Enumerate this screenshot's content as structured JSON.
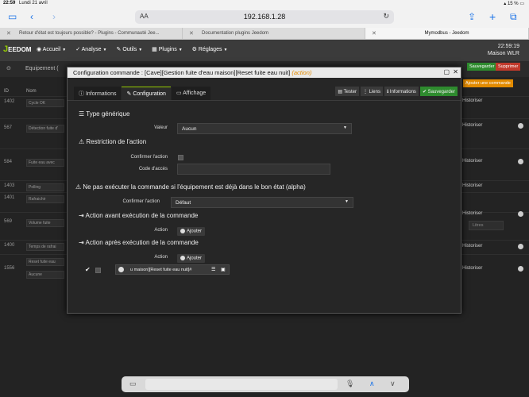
{
  "statusbar": {
    "time": "22:59",
    "date": "Lundi 21 avril",
    "battery": "15 %"
  },
  "browser": {
    "aa_label": "AA",
    "url": "192.168.1.28",
    "tabs": [
      {
        "label": "Retour d'état est toujours possible? - Plugins - Communauté Jee...",
        "active": false
      },
      {
        "label": "Documentation plugins Jeedom",
        "active": false
      },
      {
        "label": "Mymodbus - Jeedom",
        "active": true
      }
    ]
  },
  "navbar": {
    "logo": "EEDOM",
    "menu": [
      "Accueil",
      "Analyse",
      "Outils",
      "Plugins",
      "Réglages"
    ],
    "clock_time": "22:59:19",
    "clock_name": "Maison WLR"
  },
  "background": {
    "header_add": "Equipement (",
    "col_id": "ID",
    "col_nom": "Nom",
    "btn_save": "Sauvegarder",
    "btn_delete": "Supprimer",
    "btn_add_cmd": "Ajouter une commande",
    "rows": [
      {
        "id": "1402",
        "name": "Cycle OK",
        "right": "Historiser"
      },
      {
        "id": "567",
        "name": "Détection fuite d'",
        "right": "Historiser"
      },
      {
        "id": "584",
        "name": "Fuite eau avec",
        "right": "Historiser"
      },
      {
        "id": "1403",
        "name": "Polling",
        "right": "Historiser"
      },
      {
        "id": "1401",
        "name": "Rafraichir",
        "right": ""
      },
      {
        "id": "569",
        "name": "Volume fuite",
        "right": "Historiser"
      },
      {
        "id": "1400",
        "name": "Temps de rafrai",
        "right": "Historiser"
      },
      {
        "id": "1556",
        "name": "Reset fuite eau",
        "right": "Historiser"
      }
    ],
    "row_select": "Aucune",
    "unit_placeholder": "Litres"
  },
  "modal": {
    "title": "Configuration commande : [Cave][Gestion fuite d'eau maison][Reset fuite eau nuit]",
    "title_suffix": "(action)",
    "tabs": [
      "Informations",
      "Configuration",
      "Affichage"
    ],
    "buttons": {
      "test": "Tester",
      "links": "Liens",
      "infos": "Informations",
      "save": "Sauvegarder"
    },
    "type_generique": {
      "heading": "Type générique",
      "valeur_label": "Valeur",
      "valeur_value": "Aucun"
    },
    "restriction": {
      "heading": "Restriction de l'action",
      "confirmer_label": "Confirmer l'action",
      "code_label": "Code d'accès"
    },
    "ne_pas": {
      "heading": "Ne pas exécuter la commande si l'équipement est déjà dans le bon état (alpha)",
      "confirmer_label": "Confirmer l'action",
      "confirmer_value": "Défaut"
    },
    "avant": {
      "heading": "Action avant exécution de la commande",
      "action_label": "Action",
      "add_label": "Ajouter"
    },
    "apres": {
      "heading": "Action après exécution de la commande",
      "action_label": "Action",
      "add_label": "Ajouter",
      "cmd_value": "u maison][Reset fuite eau nuit]#"
    }
  }
}
